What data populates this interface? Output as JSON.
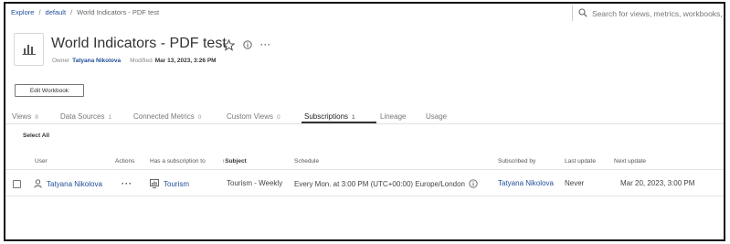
{
  "breadcrumb": {
    "items": [
      "Explore",
      "default",
      "World Indicators - PDF test"
    ],
    "separator": "/"
  },
  "search": {
    "placeholder": "Search for views, metrics, workbooks, and"
  },
  "header": {
    "title": "World Indicators - PDF test",
    "owner_label": "Owner",
    "owner_name": "Tatyana Nikolova",
    "modified_label": "Modified",
    "modified_value": "Mar 13, 2023, 3:26 PM",
    "more_label": "···"
  },
  "edit_button": {
    "label": "Edit Workbook"
  },
  "tabs": [
    {
      "label": "Views",
      "count": "8"
    },
    {
      "label": "Data Sources",
      "count": "1"
    },
    {
      "label": "Connected Metrics",
      "count": "0"
    },
    {
      "label": "Custom Views",
      "count": "0"
    },
    {
      "label": "Subscriptions",
      "count": "1"
    },
    {
      "label": "Lineage",
      "count": ""
    },
    {
      "label": "Usage",
      "count": ""
    }
  ],
  "active_tab": "Subscriptions",
  "select_all_label": "Select All",
  "table": {
    "columns": [
      "User",
      "Actions",
      "Has a subscription to",
      "Subject",
      "Schedule",
      "Subscribed by",
      "Last update",
      "Next update"
    ],
    "sorted_column": "Subject",
    "sort_arrow": "↑",
    "rows": [
      {
        "user": "Tatyana Nikolova",
        "actions": "···",
        "subscription_to": "Tourism",
        "subject": "Tourism - Weekly",
        "schedule": "Every Mon. at 3:00 PM (UTC+00:00) Europe/London",
        "subscribed_by": "Tatyana Nikolova",
        "last_update": "Never",
        "next_update": "Mar 20, 2023, 3:00 PM"
      }
    ]
  },
  "colors": {
    "link": "#1f4e99",
    "text": "#333333",
    "muted": "#777777",
    "border": "#111111"
  },
  "icons": [
    "search-icon",
    "workbook-icon",
    "star-icon",
    "info-icon",
    "more-icon",
    "user-icon",
    "view-icon",
    "info-icon"
  ]
}
